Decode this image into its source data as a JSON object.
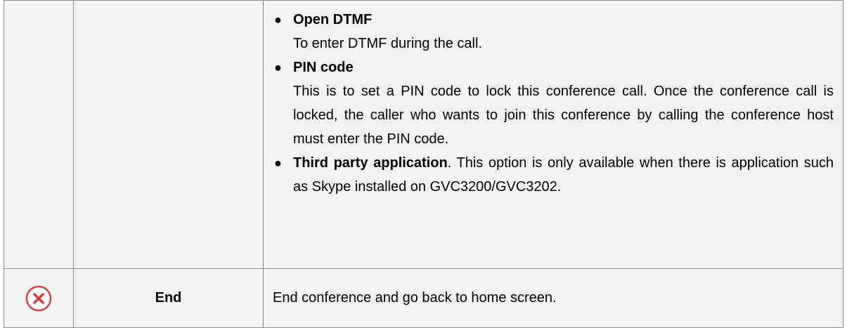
{
  "options": [
    {
      "title": "Open DTMF",
      "separator": "",
      "text": "To enter DTMF during the call."
    },
    {
      "title": "PIN code",
      "separator": "",
      "text": "This is to set a PIN code to lock this conference call. Once the conference call is locked, the caller who wants to join this conference by calling the conference host must enter the PIN code."
    },
    {
      "title": "Third party application",
      "separator": ". ",
      "text": "This option is only available when there is application such as Skype installed on GVC3200/GVC3202."
    }
  ],
  "end_row": {
    "icon": "close-circle-icon",
    "name": "End",
    "description": "End conference and go back to home screen."
  },
  "colors": {
    "cell_background": "#f2f2f2",
    "border": "#8c8c8c",
    "icon_red": "#d9383c"
  }
}
